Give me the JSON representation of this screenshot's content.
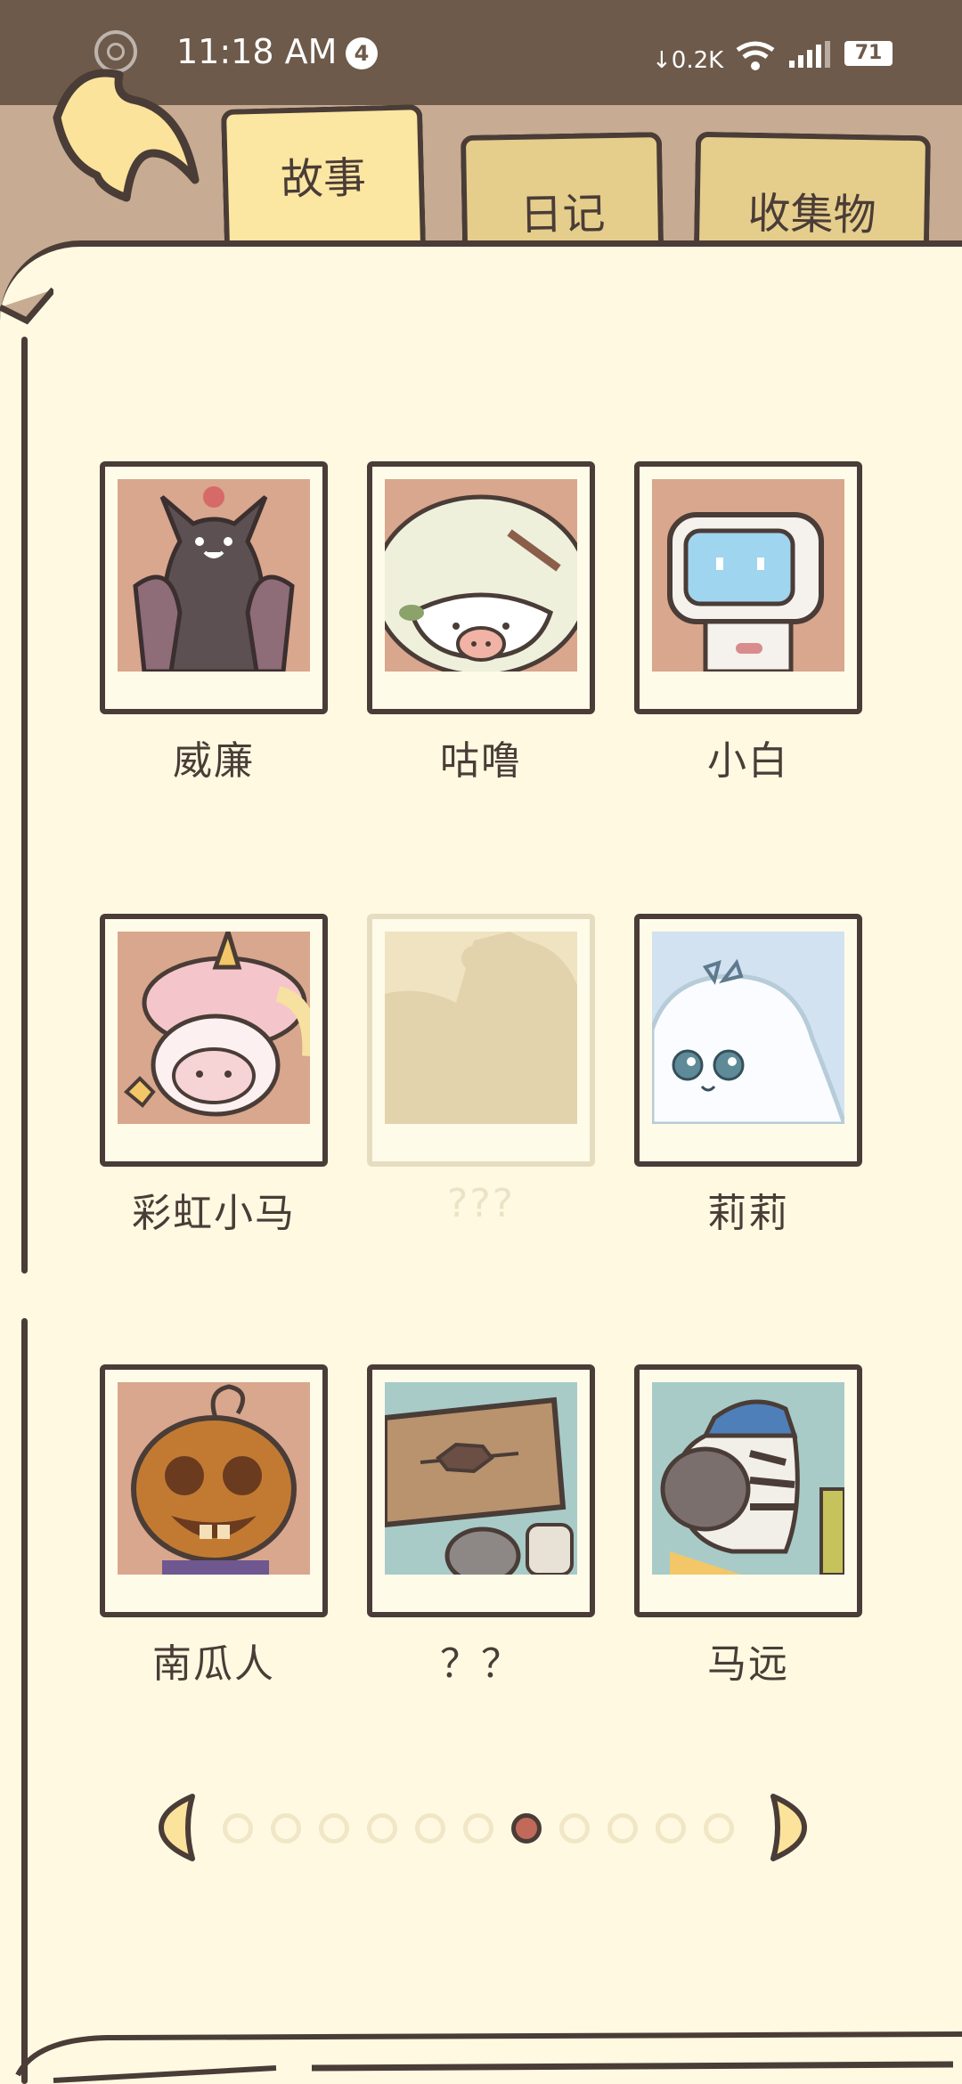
{
  "status_bar": {
    "time": "11:18 AM",
    "notification_count": "4",
    "network_speed": "0.2K",
    "battery": "71"
  },
  "tabs": [
    {
      "label": "故事",
      "active": true
    },
    {
      "label": "日记",
      "active": false
    },
    {
      "label": "收集物",
      "active": false
    }
  ],
  "characters": [
    {
      "name": "威廉",
      "locked": false,
      "bg": "#d9a68e"
    },
    {
      "name": "咕噜",
      "locked": false,
      "bg": "#d9a68e"
    },
    {
      "name": "小白",
      "locked": false,
      "bg": "#d9a68e"
    },
    {
      "name": "彩虹小马",
      "locked": false,
      "bg": "#d9a68e"
    },
    {
      "name": "???",
      "locked": true,
      "bg": "#efe3c2"
    },
    {
      "name": "莉莉",
      "locked": false,
      "bg": "#d2e2f1"
    },
    {
      "name": "南瓜人",
      "locked": false,
      "bg": "#d9a68e"
    },
    {
      "name": "？？",
      "locked": false,
      "bg": "#a8cbc8"
    },
    {
      "name": "马远",
      "locked": false,
      "bg": "#a8cbc8"
    }
  ],
  "pager": {
    "total_pages": 11,
    "current_page": 7
  },
  "colors": {
    "outline": "#4a3c36",
    "paper": "#fff9e2",
    "tab_active": "#fbe6a2",
    "tab_inactive": "#e5cd8c",
    "pager_active": "#c16a5a"
  }
}
